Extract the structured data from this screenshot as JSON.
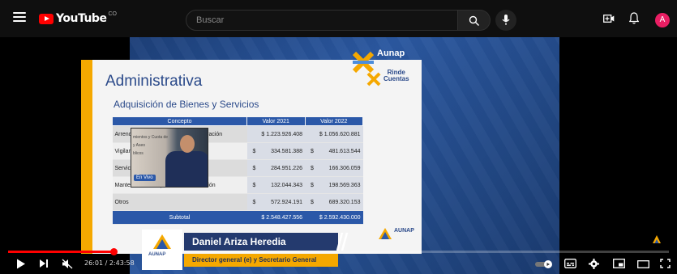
{
  "app": {
    "logo_text": "YouTube",
    "logo_region": "CO",
    "avatar_letter": "A",
    "colors": {
      "brand": "#ff0000",
      "background": "#0f0f0f",
      "avatar": "#e91e63",
      "accent_blue": "#2b58a8",
      "accent_yellow": "#f5a800"
    }
  },
  "search": {
    "placeholder": "Buscar"
  },
  "icons": {
    "menu": "menu-icon",
    "search": "search-icon",
    "mic": "mic-icon",
    "create": "create-icon",
    "notifications": "bell-icon"
  },
  "slide": {
    "brand_top": "Aunap",
    "brand_rinde": "Rinde",
    "brand_cuentas": "Cuentas",
    "title": "Administrativa",
    "subtitle": "Adquisición de Bienes y Servicios",
    "table": {
      "headers": [
        "Concepto",
        "Valor 2021",
        "Valor 2022"
      ],
      "rows": [
        {
          "concept": "Arrendamientos y Cuota de Administración",
          "v2021": "$ 1.223.926.408",
          "v2022": "$ 1.056.620.881"
        },
        {
          "concept": "Vigilancia y Aseo",
          "cur1": "$",
          "v2021": "334.581.388",
          "cur2": "$",
          "v2022": "481.613.544"
        },
        {
          "concept": "Servicios Públicos",
          "cur1": "$",
          "v2021": "284.951.226",
          "cur2": "$",
          "v2022": "166.306.059"
        },
        {
          "concept": "Mantenimiento, reparación e Instalación",
          "cur1": "$",
          "v2021": "132.044.343",
          "cur2": "$",
          "v2022": "198.569.363"
        },
        {
          "concept": "Otros",
          "cur1": "$",
          "v2021": "572.924.191",
          "cur2": "$",
          "v2022": "689.320.153"
        }
      ],
      "subtotal": {
        "label": "Subtotal",
        "v2021": "$ 2.548.427.556",
        "v2022": "$ 2.592.430.000"
      }
    },
    "corner_logo": "AUNAP"
  },
  "pip": {
    "text_line1": "mientos y Cuota de",
    "text_line2": "ración",
    "text_line3": "y Aseo",
    "text_line4": "blicos",
    "live_badge": "En Vivo"
  },
  "lower_third": {
    "logo": "AUNAP",
    "name": "Daniel Ariza Heredia",
    "role": "Director general (e) y Secretario General"
  },
  "player": {
    "time": "26:01 / 2:43:58",
    "progress": 0.16
  }
}
